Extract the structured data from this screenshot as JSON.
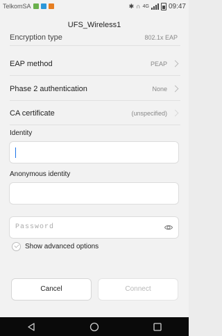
{
  "status_bar": {
    "carrier": "TelkomSA",
    "network": "4G",
    "time": "09:47",
    "notification_colors": [
      "#6ab04c",
      "#2d98da",
      "#e67e22"
    ]
  },
  "dialog": {
    "title": "UFS_Wireless1"
  },
  "rows": [
    {
      "label": "Encryption type",
      "value": "802.1x EAP"
    },
    {
      "label": "EAP method",
      "value": "PEAP"
    },
    {
      "label": "Phase 2 authentication",
      "value": "None"
    },
    {
      "label": "CA certificate",
      "value": "(unspecified)"
    }
  ],
  "fields": {
    "identity_label": "Identity",
    "identity_value": "",
    "anonymous_label": "Anonymous identity",
    "anonymous_value": "",
    "password_placeholder": "Password"
  },
  "advanced": {
    "label": "Show advanced options",
    "checked": false
  },
  "buttons": {
    "cancel": "Cancel",
    "connect": "Connect"
  },
  "icons": {
    "eye": "eye-icon",
    "back": "back-icon",
    "home": "home-icon",
    "recents": "recents-icon"
  }
}
